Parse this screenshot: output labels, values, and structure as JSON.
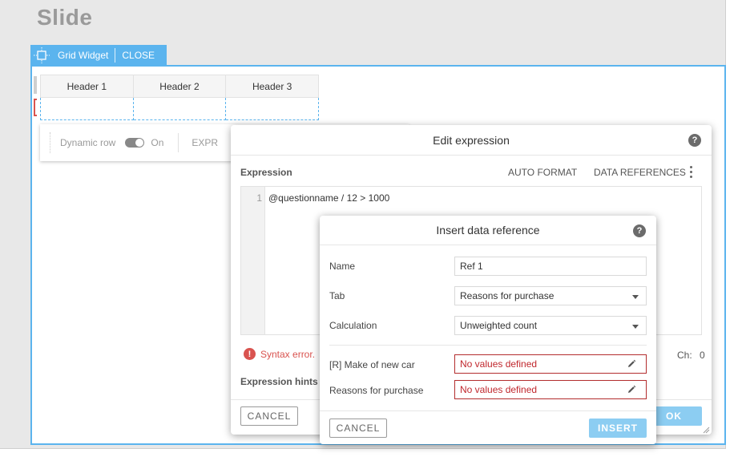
{
  "slide": {
    "title": "Slide"
  },
  "widget_tab": {
    "name": "Grid Widget",
    "close_label": "CLOSE"
  },
  "grid": {
    "headers": [
      "Header 1",
      "Header 2",
      "Header 3"
    ]
  },
  "row_toolbar": {
    "dynamic_row_label": "Dynamic row",
    "toggle_state": "On",
    "expr_label": "EXPR"
  },
  "edit_expression": {
    "title": "Edit expression",
    "expression_label": "Expression",
    "auto_format_label": "AUTO FORMAT",
    "data_references_label": "DATA REFERENCES",
    "line_number": "1",
    "code": "@questionname / 12 > 1000",
    "syntax_error": "Syntax error.",
    "char_count_label": "Ch:",
    "char_count_value": "0",
    "hints_label": "Expression hints",
    "cancel_label": "CANCEL",
    "ok_label": "OK"
  },
  "insert_reference": {
    "title": "Insert data reference",
    "name_label": "Name",
    "name_value": "Ref 1",
    "tab_label": "Tab",
    "tab_value": "Reasons for purchase",
    "calculation_label": "Calculation",
    "calculation_value": "Unweighted count",
    "rows": [
      {
        "label": "[R] Make of new car",
        "value": "No values defined"
      },
      {
        "label": "Reasons for purchase",
        "value": "No values defined"
      }
    ],
    "cancel_label": "CANCEL",
    "insert_label": "INSERT"
  },
  "colors": {
    "accent": "#5bb4ee",
    "error": "#d9534f",
    "button_fill": "#8ccdf2"
  }
}
